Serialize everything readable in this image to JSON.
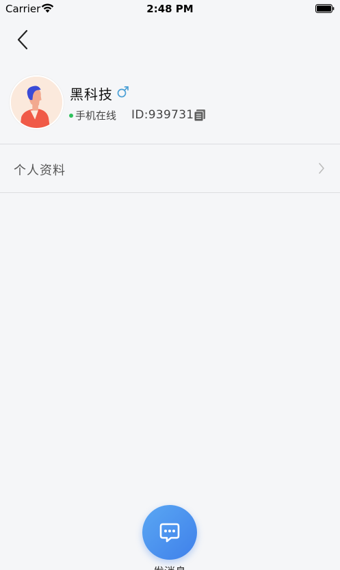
{
  "status_bar": {
    "carrier": "Carrier",
    "time": "2:48 PM",
    "wifi_icon": "wifi-icon",
    "battery_icon": "battery-icon"
  },
  "nav": {
    "back_icon": "chevron-left-icon"
  },
  "profile": {
    "name": "黑科技",
    "gender_icon": "male-icon",
    "gender_color": "#4a9fd5",
    "online_status": "手机在线",
    "online_color": "#2ec05c",
    "user_id": "ID:939731",
    "copy_icon": "copy-icon"
  },
  "menu": {
    "items": [
      {
        "label": "个人资料",
        "icon": "chevron-right-icon"
      }
    ]
  },
  "actions": {
    "send_message_label": "发消息",
    "send_message_icon": "chat-bubble-icon",
    "accent_color": "#4a90ef"
  }
}
